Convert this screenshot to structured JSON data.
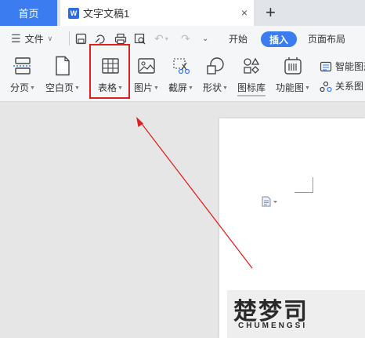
{
  "tabs": {
    "home": "首页",
    "doc_icon": "W",
    "doc_title": "文字文稿1",
    "close": "×",
    "add": "+"
  },
  "menu": {
    "file": "文件",
    "start": "开始",
    "insert": "插入",
    "layout": "页面布局"
  },
  "ribbon": {
    "page_break": "分页",
    "blank_page": "空白页",
    "table": "表格",
    "picture": "图片",
    "screenshot": "截屏",
    "shape": "形状",
    "icon_lib": "图标库",
    "func_chart": "功能图",
    "smart_shape": "智能图形",
    "relation_chart": "关系图"
  },
  "watermark": {
    "main": "楚梦司",
    "sub": "CHUMENGSI"
  },
  "colors": {
    "accent": "#3b7cf0",
    "highlight": "#e02020"
  }
}
